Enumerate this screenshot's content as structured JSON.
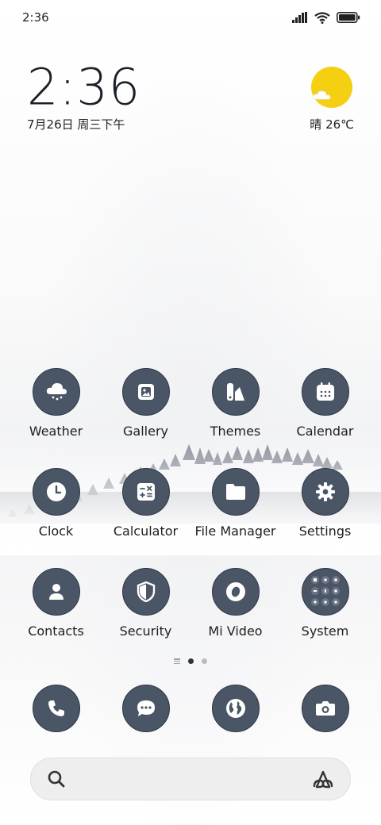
{
  "status_bar": {
    "time": "2:36",
    "icons": [
      "signal-icon",
      "wifi-icon",
      "battery-icon"
    ]
  },
  "clock_widget": {
    "time": "2:36",
    "date": "7月26日 周三下午"
  },
  "weather_widget": {
    "text": "晴 26℃",
    "icon": "sunny-partly-cloudy-icon",
    "sun_color": "#F5CF12"
  },
  "apps": [
    {
      "label": "Weather",
      "icon": "weather-cloud-icon"
    },
    {
      "label": "Gallery",
      "icon": "gallery-icon"
    },
    {
      "label": "Themes",
      "icon": "themes-icon"
    },
    {
      "label": "Calendar",
      "icon": "calendar-icon"
    },
    {
      "label": "Clock",
      "icon": "clock-icon"
    },
    {
      "label": "Calculator",
      "icon": "calculator-icon"
    },
    {
      "label": "File Manager",
      "icon": "folder-icon"
    },
    {
      "label": "Settings",
      "icon": "gear-icon"
    },
    {
      "label": "Contacts",
      "icon": "person-icon"
    },
    {
      "label": "Security",
      "icon": "shield-icon"
    },
    {
      "label": "Mi Video",
      "icon": "video-icon"
    },
    {
      "label": "System",
      "icon": "folder-grid-icon"
    }
  ],
  "page_indicator": {
    "pages": 2,
    "current": 1,
    "active_color": "#333333",
    "inactive_color": "#BBBBBB"
  },
  "dock": [
    {
      "icon": "phone-icon"
    },
    {
      "icon": "messages-icon"
    },
    {
      "icon": "browser-globe-icon"
    },
    {
      "icon": "camera-icon"
    }
  ],
  "search_bar": {
    "left_icon": "search-icon",
    "right_icon": "assistant-logo-icon"
  },
  "colors": {
    "icon_bg": "#4A5565",
    "icon_border": "#2F3846",
    "text": "#1E1E1E"
  }
}
